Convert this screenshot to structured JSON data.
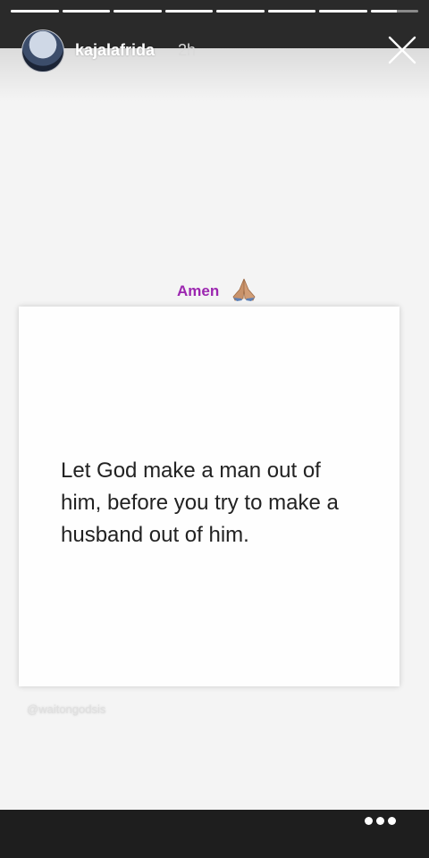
{
  "story": {
    "progress_segments": 8,
    "active_segment_index": 7,
    "active_segment_fill_fraction": 0.55
  },
  "header": {
    "username": "kajalafrida",
    "timestamp": "2h"
  },
  "post": {
    "caption": "Amen",
    "caption_emoji": "praying-hands-emoji",
    "quote_text": "Let God make a man out of him, before you try to make a husband out of him.",
    "watermark": "@waitongodsis"
  },
  "colors": {
    "caption_color": "#9c27b0",
    "top_bar": "#2a2a2a",
    "bottom_bar": "#1e1e1e"
  },
  "icons": {
    "close": "close-icon",
    "more": "more-icon"
  }
}
